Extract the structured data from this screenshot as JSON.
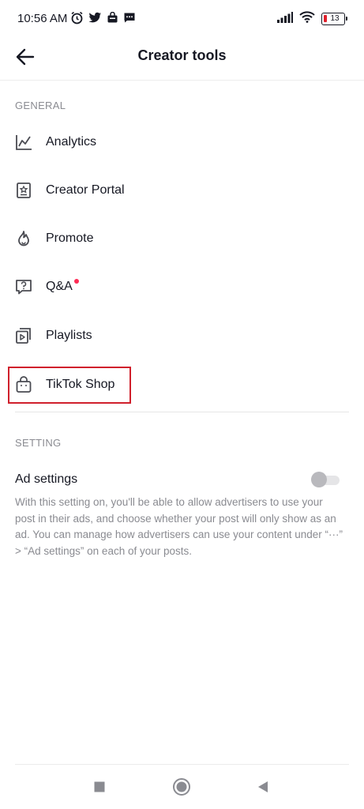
{
  "status_bar": {
    "time": "10:56 AM",
    "left_icons": [
      "alarm-icon",
      "twitter-icon",
      "bag-icon",
      "message-icon"
    ],
    "right_icons": [
      "signal-icon",
      "wifi-icon"
    ],
    "battery": "13"
  },
  "header": {
    "title": "Creator tools"
  },
  "general": {
    "section_label": "GENERAL",
    "items": [
      {
        "label": "Analytics",
        "icon": "analytics-icon"
      },
      {
        "label": "Creator Portal",
        "icon": "creator-portal-icon"
      },
      {
        "label": "Promote",
        "icon": "flame-icon"
      },
      {
        "label": "Q&A",
        "icon": "qa-icon"
      },
      {
        "label": "Playlists",
        "icon": "playlist-icon"
      },
      {
        "label": "TikTok Shop",
        "icon": "shop-bag-icon"
      }
    ]
  },
  "setting": {
    "section_label": "SETTING",
    "ad_label": "Ad settings",
    "ad_toggle_on": false,
    "ad_description": "With this setting on, you'll be able to allow advertisers to use your post in their ads, and choose whether your post will only show as an ad. You can manage how advertisers can use your content under “···” > “Ad settings” on each of your posts."
  },
  "colors": {
    "accent_dot": "#fe2c55",
    "highlight_border": "#d0202c",
    "battery_low": "#e0202c"
  }
}
